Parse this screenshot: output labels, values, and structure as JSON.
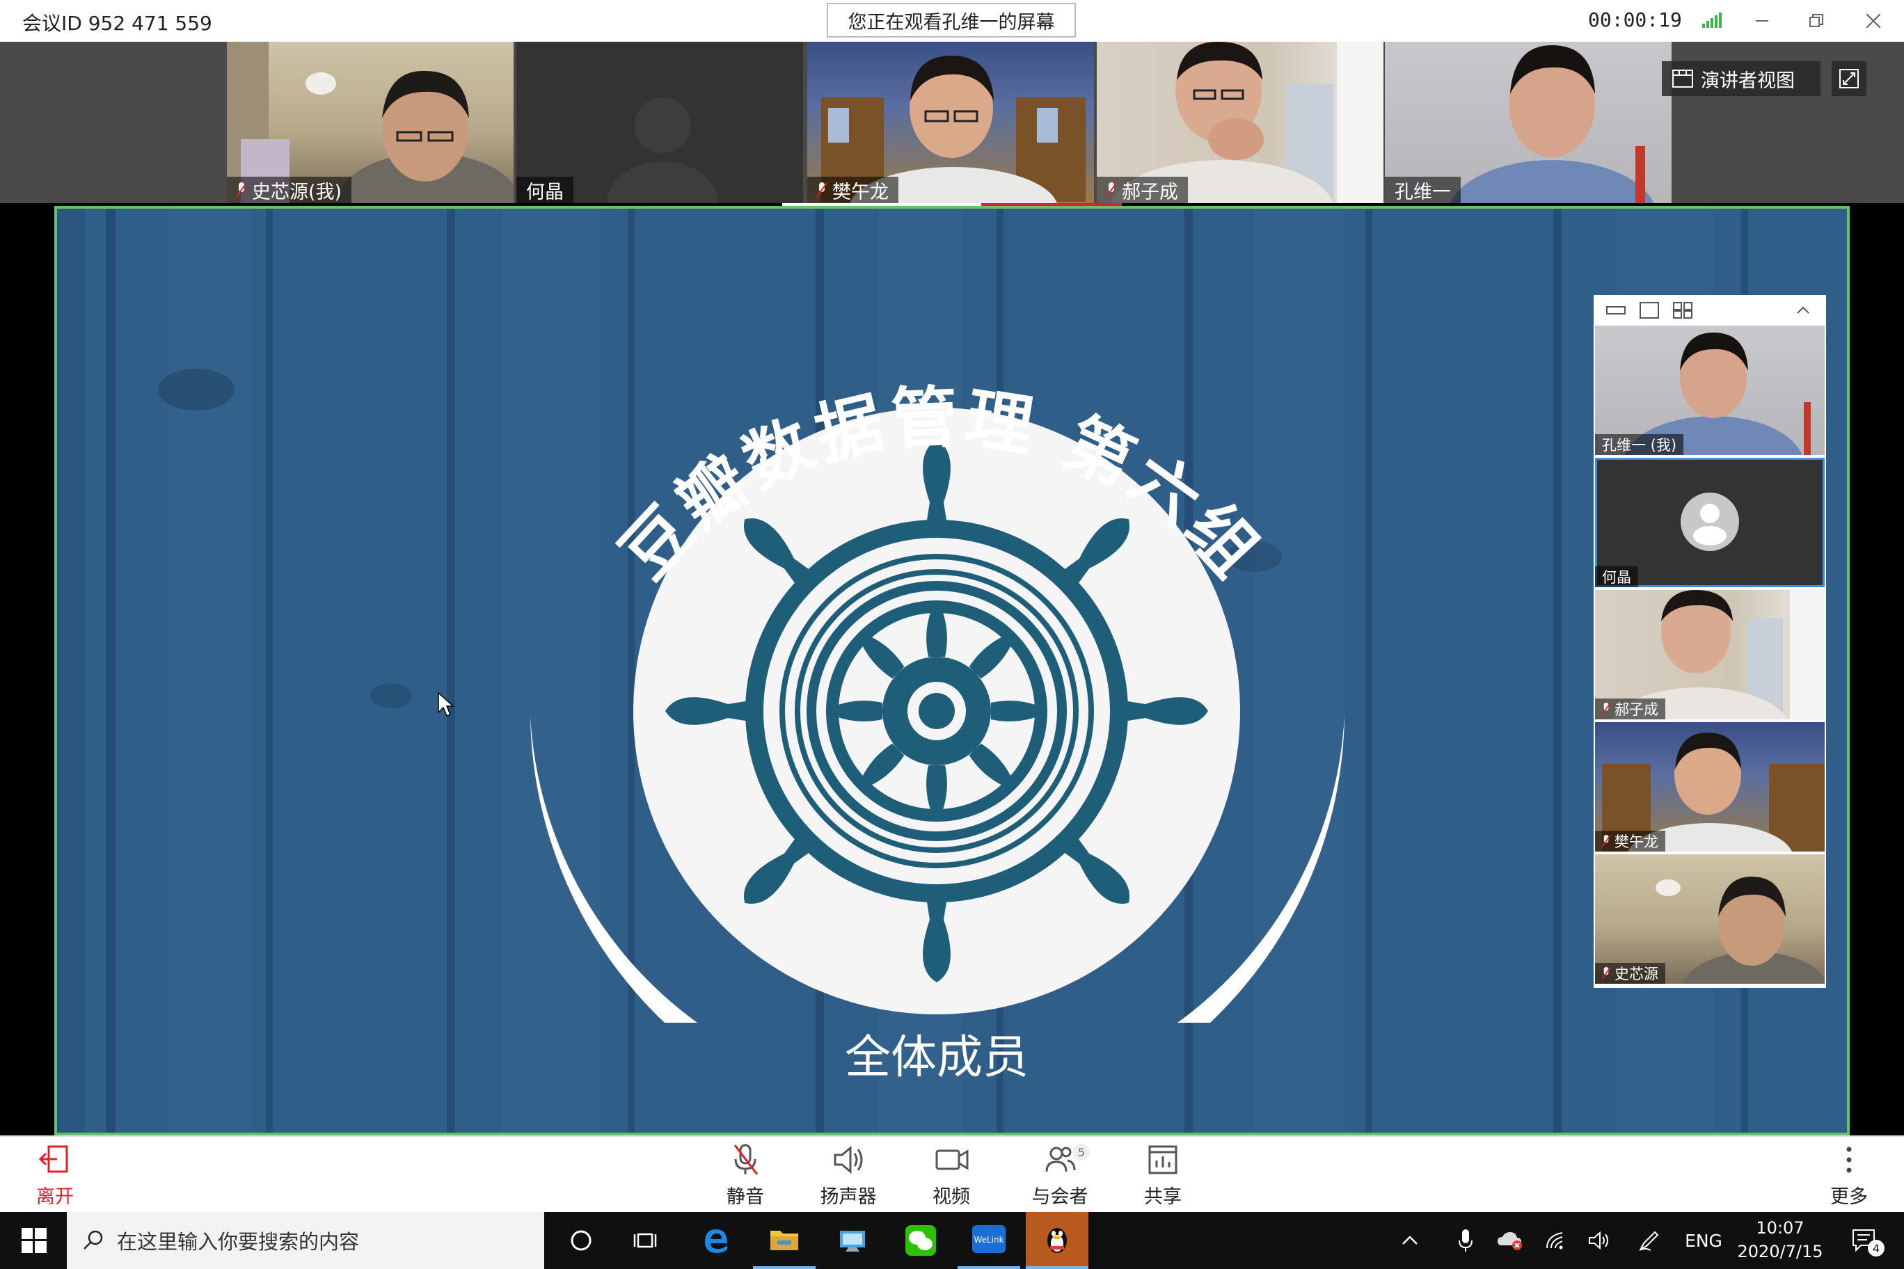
{
  "titlebar": {
    "meeting_id": "会议ID 952 471 559",
    "viewing_text": "您正在观看孔维一的屏幕",
    "timer": "00:00:19"
  },
  "participants": [
    {
      "name": "史芯源(我)",
      "muted": true
    },
    {
      "name": "何晶",
      "muted": false
    },
    {
      "name": "樊午龙",
      "muted": true
    },
    {
      "name": "郝子成",
      "muted": true
    },
    {
      "name": "孔维一",
      "muted": false
    }
  ],
  "speaker_view_label": "演讲者视图",
  "slide": {
    "title": "豆瓣数据管理 第六组",
    "subtitle": "全体成员"
  },
  "gallery": [
    {
      "name": "孔维一 (我)"
    },
    {
      "name": "何晶"
    },
    {
      "name": "郝子成"
    },
    {
      "name": "樊午龙"
    },
    {
      "name": "史芯源"
    }
  ],
  "toolbar": {
    "leave": "离开",
    "mute": "静音",
    "speaker": "扬声器",
    "video": "视频",
    "participants": "与会者",
    "participants_count": "5",
    "share": "共享",
    "more": "更多"
  },
  "taskbar": {
    "search_placeholder": "在这里输入你要搜索的内容",
    "lang": "ENG",
    "time": "10:07",
    "date": "2020/7/15",
    "notifications": "4",
    "welink": "WeLink"
  },
  "colors": {
    "accent_red": "#e21e2a",
    "share_border": "#62c36c",
    "slide_blue": "#2e5e86",
    "wheel": "#1f5e78"
  }
}
